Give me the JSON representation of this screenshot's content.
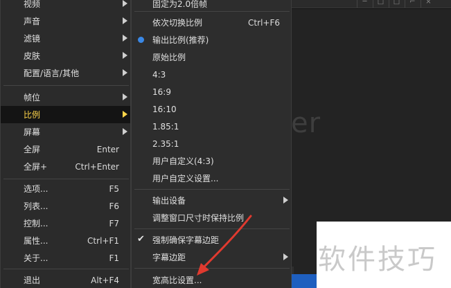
{
  "background": {
    "player_text": "er",
    "watermark": "软件技巧"
  },
  "main_menu": {
    "items": [
      {
        "label": "视频",
        "shortcut": "",
        "submenu": true
      },
      {
        "label": "声音",
        "shortcut": "",
        "submenu": true
      },
      {
        "label": "滤镜",
        "shortcut": "",
        "submenu": true
      },
      {
        "label": "皮肤",
        "shortcut": "",
        "submenu": true
      },
      {
        "label": "配置/语言/其他",
        "shortcut": "",
        "submenu": true
      },
      {
        "label": "帧位",
        "shortcut": "",
        "submenu": true
      },
      {
        "label": "比例",
        "shortcut": "",
        "submenu": true
      },
      {
        "label": "屏幕",
        "shortcut": "",
        "submenu": true
      },
      {
        "label": "全屏",
        "shortcut": "Enter",
        "submenu": false
      },
      {
        "label": "全屏+",
        "shortcut": "Ctrl+Enter",
        "submenu": false
      },
      {
        "label": "选项...",
        "shortcut": "F5",
        "submenu": false
      },
      {
        "label": "列表...",
        "shortcut": "F6",
        "submenu": false
      },
      {
        "label": "控制...",
        "shortcut": "F7",
        "submenu": false
      },
      {
        "label": "属性...",
        "shortcut": "Ctrl+F1",
        "submenu": false
      },
      {
        "label": "关于...",
        "shortcut": "F1",
        "submenu": false
      },
      {
        "label": "退出",
        "shortcut": "Alt+F4",
        "submenu": false
      }
    ],
    "active_index": 6
  },
  "sub_menu": {
    "items": [
      {
        "label": "固定为2.0倍帧",
        "shortcut": ""
      },
      {
        "label": "依次切换比例",
        "shortcut": "Ctrl+F6"
      },
      {
        "label": "输出比例(推荐)",
        "shortcut": "",
        "selected": true
      },
      {
        "label": "原始比例",
        "shortcut": ""
      },
      {
        "label": "4:3",
        "shortcut": ""
      },
      {
        "label": "16:9",
        "shortcut": ""
      },
      {
        "label": "16:10",
        "shortcut": ""
      },
      {
        "label": "1.85:1",
        "shortcut": ""
      },
      {
        "label": "2.35:1",
        "shortcut": ""
      },
      {
        "label": "用户自定义(4:3)",
        "shortcut": ""
      },
      {
        "label": "用户自定义设置...",
        "shortcut": ""
      },
      {
        "label": "输出设备",
        "shortcut": "",
        "submenu": true
      },
      {
        "label": "调整窗口尺寸时保持比例",
        "shortcut": ""
      },
      {
        "label": "强制确保字幕边距",
        "shortcut": "",
        "checked": true
      },
      {
        "label": "字幕边距",
        "shortcut": "",
        "submenu": true
      },
      {
        "label": "宽高比设置...",
        "shortcut": ""
      }
    ]
  },
  "colors": {
    "menu_bg": "#2b2b2b",
    "active_text": "#ffd54a",
    "radio_accent": "#3a88e6",
    "annotation_arrow": "#e03a2f"
  }
}
